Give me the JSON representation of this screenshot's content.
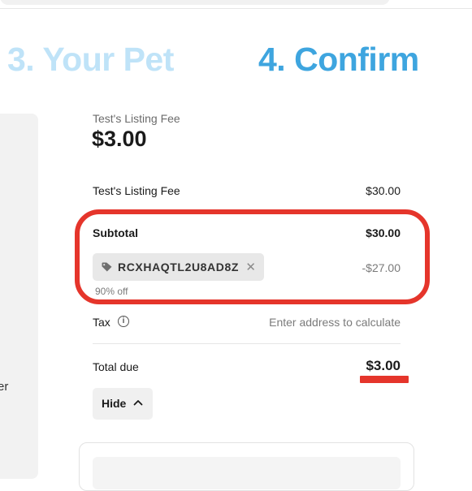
{
  "steps": {
    "pet": "3. Your Pet",
    "confirm": "4. Confirm",
    "colors": {
      "inactive": "#bfe3f8",
      "active": "#3ea5df"
    }
  },
  "left_panel": {
    "clipped_text": "er"
  },
  "summary": {
    "label": "Test's Listing Fee",
    "amount": "$3.00"
  },
  "line_item": {
    "label": "Test's Listing Fee",
    "value": "$30.00"
  },
  "subtotal": {
    "label": "Subtotal",
    "value": "$30.00"
  },
  "promo": {
    "icon": "tag-icon",
    "code": "RCXHAQTL2U8AD8Z",
    "remove_symbol": "✕",
    "discount": "-$27.00",
    "note": "90% off"
  },
  "tax": {
    "label": "Tax",
    "info_symbol": "i",
    "value": "Enter address to calculate"
  },
  "total": {
    "label": "Total due",
    "value": "$3.00"
  },
  "hide_button": {
    "label": "Hide",
    "icon": "chevron-up-icon"
  },
  "annotations": {
    "highlight_color": "#e5352b"
  }
}
